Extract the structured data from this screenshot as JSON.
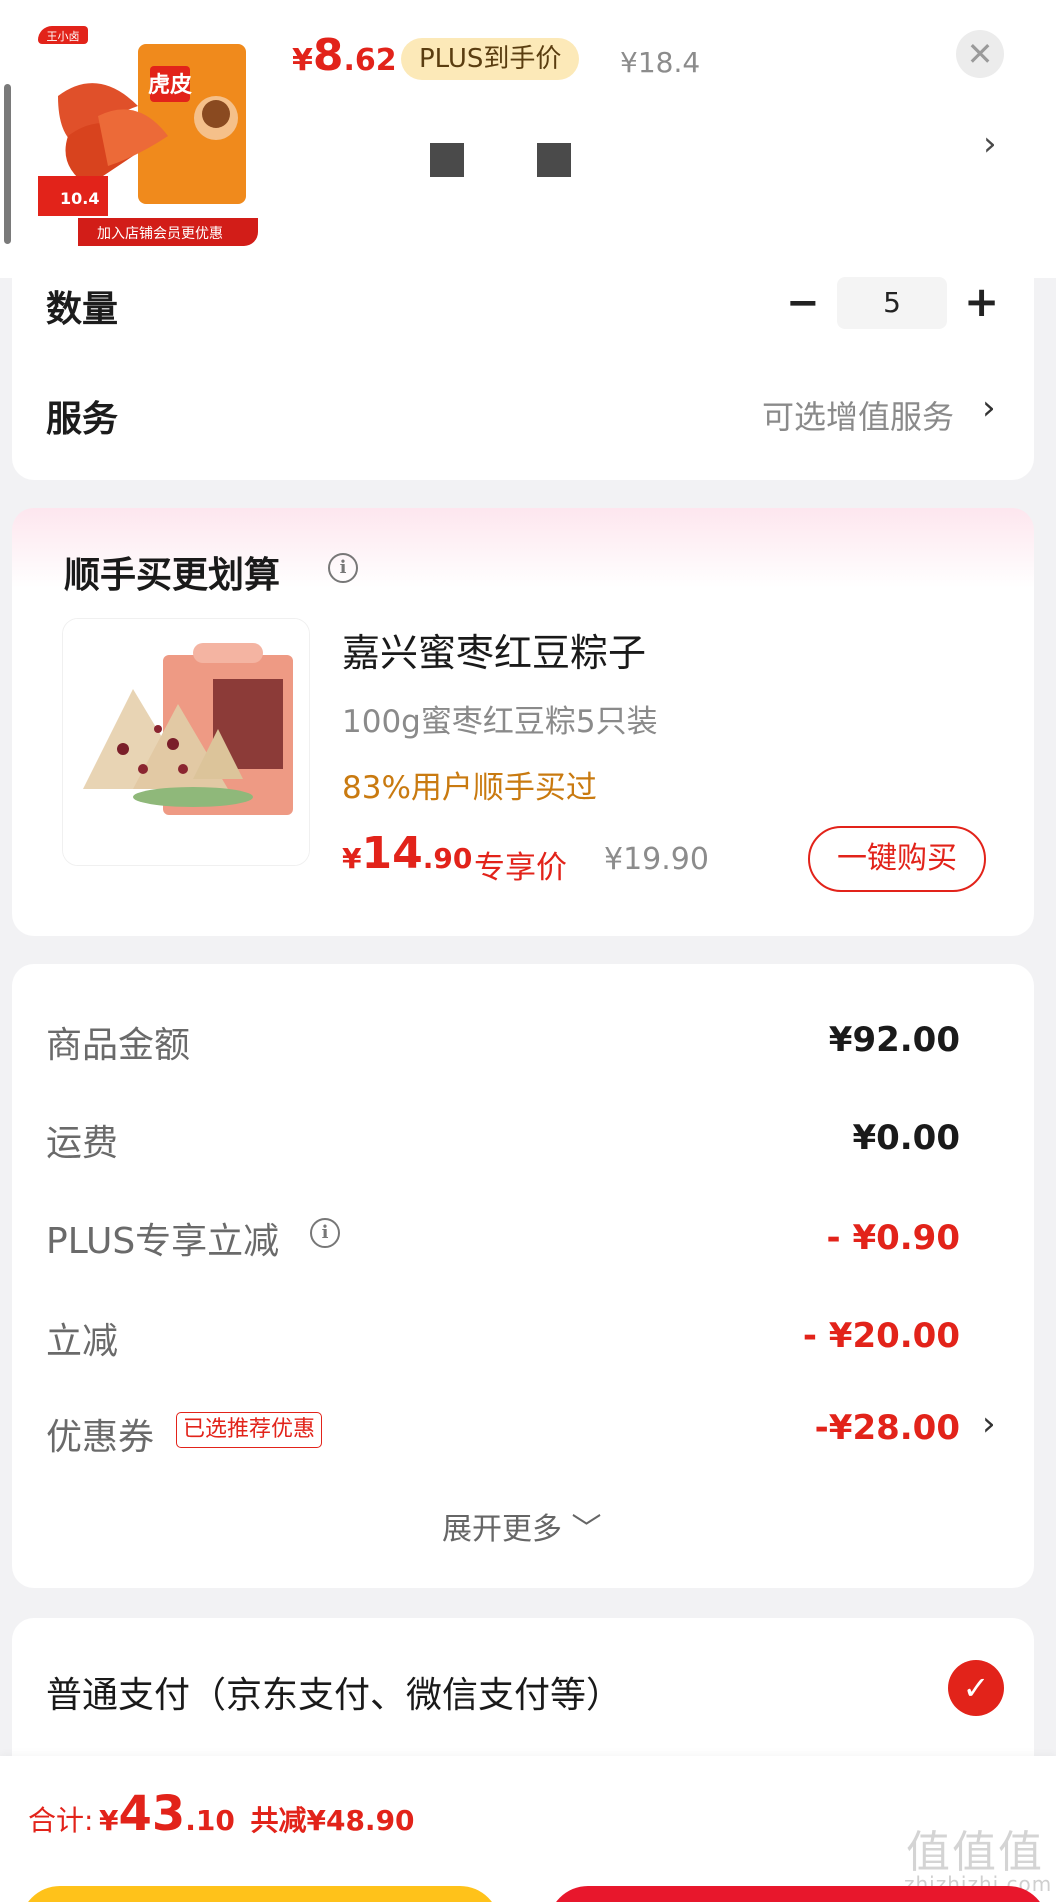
{
  "product": {
    "currency": "¥",
    "price_int": "8",
    "price_dec": ".62",
    "plus_label": "PLUS到手价",
    "orig_price": "¥18.4",
    "image_logo": "王小卤",
    "image_brand": "虎皮",
    "image_promo": "加入店铺会员更优惠",
    "image_badge": "10.4"
  },
  "quantity": {
    "label": "数量",
    "minus": "−",
    "value": "5",
    "plus": "+"
  },
  "service": {
    "label": "服务",
    "value": "可选增值服务",
    "chevron": "›"
  },
  "bundle": {
    "title": "顺手买更划算",
    "info": "i",
    "name": "嘉兴蜜枣红豆粽子",
    "spec": "100g蜜枣红豆粽5只装",
    "social": "83%用户顺手买过",
    "currency": "¥",
    "price_int": "14",
    "price_dec": ".90",
    "tag": "专享价",
    "orig_price": "¥19.90",
    "buy_button": "一键购买"
  },
  "summary": {
    "rows": [
      {
        "label": "商品金额",
        "value": "¥92.00"
      },
      {
        "label": "运费",
        "value": "¥0.00"
      },
      {
        "label": "PLUS专享立减",
        "value": "- ¥0.90"
      },
      {
        "label": "立减",
        "value": "- ¥20.00"
      },
      {
        "label": "优惠券",
        "value": "-¥28.00"
      }
    ],
    "coupon_tag": "已选推荐优惠",
    "expand": "展开更多 ﹀"
  },
  "payment": {
    "label": "普通支付（京东支付、微信支付等）",
    "check": "✓"
  },
  "footer": {
    "total_label": "合计:",
    "currency": "¥",
    "total_int": "43",
    "total_dec": ".10",
    "saved": "共减¥48.90"
  },
  "watermark": {
    "main": "值值值",
    "sub": "zhizhizhi.com"
  },
  "colors": {
    "accent": "#e2231a",
    "plus_bg": "#fce9b8",
    "yellow": "#ffc21a"
  }
}
